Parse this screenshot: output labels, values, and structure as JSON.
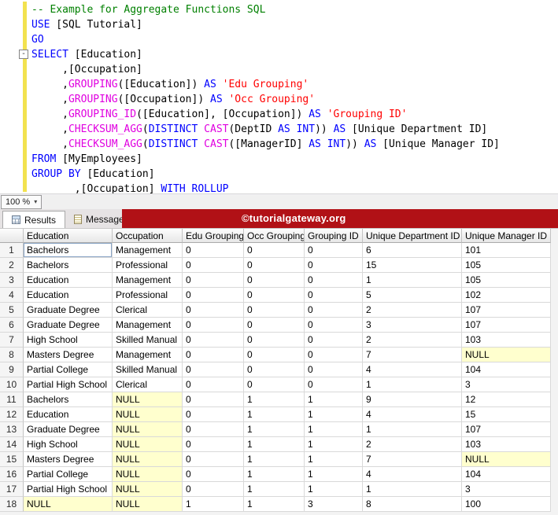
{
  "editor": {
    "zoom": "100 %",
    "lines": [
      [
        {
          "t": "-- Example for Aggregate Functions SQL",
          "c": "comment"
        }
      ],
      [
        {
          "t": "USE",
          "c": "kw"
        },
        {
          "t": " [SQL Tutorial]",
          "c": "plain"
        }
      ],
      [
        {
          "t": "GO",
          "c": "kw"
        }
      ],
      [
        {
          "t": "SELECT",
          "c": "kw"
        },
        {
          "t": " [Education]",
          "c": "plain"
        }
      ],
      [
        {
          "t": "     ,[Occupation]",
          "c": "plain"
        }
      ],
      [
        {
          "t": "     ,",
          "c": "plain"
        },
        {
          "t": "GROUPING",
          "c": "fn"
        },
        {
          "t": "([Education]) ",
          "c": "plain"
        },
        {
          "t": "AS ",
          "c": "kw"
        },
        {
          "t": "'Edu Grouping'",
          "c": "str"
        }
      ],
      [
        {
          "t": "     ,",
          "c": "plain"
        },
        {
          "t": "GROUPING",
          "c": "fn"
        },
        {
          "t": "([Occupation]) ",
          "c": "plain"
        },
        {
          "t": "AS ",
          "c": "kw"
        },
        {
          "t": "'Occ Grouping'",
          "c": "str"
        }
      ],
      [
        {
          "t": "     ,",
          "c": "plain"
        },
        {
          "t": "GROUPING_ID",
          "c": "fn"
        },
        {
          "t": "([Education], [Occupation]) ",
          "c": "plain"
        },
        {
          "t": "AS ",
          "c": "kw"
        },
        {
          "t": "'Grouping ID'",
          "c": "str"
        }
      ],
      [
        {
          "t": "     ,",
          "c": "plain"
        },
        {
          "t": "CHECKSUM_AGG",
          "c": "fn"
        },
        {
          "t": "(",
          "c": "plain"
        },
        {
          "t": "DISTINCT ",
          "c": "kw"
        },
        {
          "t": "CAST",
          "c": "fn"
        },
        {
          "t": "(DeptID ",
          "c": "plain"
        },
        {
          "t": "AS INT",
          "c": "kw"
        },
        {
          "t": ")) ",
          "c": "plain"
        },
        {
          "t": "AS ",
          "c": "kw"
        },
        {
          "t": "[Unique Department ID]",
          "c": "plain"
        }
      ],
      [
        {
          "t": "     ,",
          "c": "plain"
        },
        {
          "t": "CHECKSUM_AGG",
          "c": "fn"
        },
        {
          "t": "(",
          "c": "plain"
        },
        {
          "t": "DISTINCT ",
          "c": "kw"
        },
        {
          "t": "CAST",
          "c": "fn"
        },
        {
          "t": "([ManagerID] ",
          "c": "plain"
        },
        {
          "t": "AS INT",
          "c": "kw"
        },
        {
          "t": ")) ",
          "c": "plain"
        },
        {
          "t": "AS ",
          "c": "kw"
        },
        {
          "t": "[Unique Manager ID]",
          "c": "plain"
        }
      ],
      [
        {
          "t": "FROM",
          "c": "kw"
        },
        {
          "t": " [MyEmployees]",
          "c": "plain"
        }
      ],
      [
        {
          "t": "GROUP BY",
          "c": "kw"
        },
        {
          "t": " [Education]",
          "c": "plain"
        }
      ],
      [
        {
          "t": "       ,[Occupation] ",
          "c": "plain"
        },
        {
          "t": "WITH ROLLUP",
          "c": "kw"
        }
      ]
    ]
  },
  "code_colors": {
    "keyword": "#0000ff",
    "comment": "#008000",
    "function": "#e000e0",
    "string": "#ff0000",
    "plain": "#000000"
  },
  "icons": {
    "dropdown_caret": "▾",
    "fold_collapse": "-"
  },
  "tabs": {
    "results": {
      "label": "Results"
    },
    "messages": {
      "label": "Messages"
    }
  },
  "banner": {
    "text": "©tutorialgateway.org",
    "color": "#b11116"
  },
  "grid": {
    "columns": [
      "Education",
      "Occupation",
      "Edu Grouping",
      "Occ Grouping",
      "Grouping ID",
      "Unique Department ID",
      "Unique Manager ID"
    ],
    "rows": [
      {
        "n": "1",
        "cells": [
          "Bachelors",
          "Management",
          "0",
          "0",
          "0",
          "6",
          "101"
        ]
      },
      {
        "n": "2",
        "cells": [
          "Bachelors",
          "Professional",
          "0",
          "0",
          "0",
          "15",
          "105"
        ]
      },
      {
        "n": "3",
        "cells": [
          "Education",
          "Management",
          "0",
          "0",
          "0",
          "1",
          "105"
        ]
      },
      {
        "n": "4",
        "cells": [
          "Education",
          "Professional",
          "0",
          "0",
          "0",
          "5",
          "102"
        ]
      },
      {
        "n": "5",
        "cells": [
          "Graduate Degree",
          "Clerical",
          "0",
          "0",
          "0",
          "2",
          "107"
        ]
      },
      {
        "n": "6",
        "cells": [
          "Graduate Degree",
          "Management",
          "0",
          "0",
          "0",
          "3",
          "107"
        ]
      },
      {
        "n": "7",
        "cells": [
          "High School",
          "Skilled Manual",
          "0",
          "0",
          "0",
          "2",
          "103"
        ]
      },
      {
        "n": "8",
        "cells": [
          "Masters Degree",
          "Management",
          "0",
          "0",
          "0",
          "7",
          "NULL"
        ]
      },
      {
        "n": "9",
        "cells": [
          "Partial College",
          "Skilled Manual",
          "0",
          "0",
          "0",
          "4",
          "104"
        ]
      },
      {
        "n": "10",
        "cells": [
          "Partial High School",
          "Clerical",
          "0",
          "0",
          "0",
          "1",
          "3"
        ]
      },
      {
        "n": "11",
        "cells": [
          "Bachelors",
          "NULL",
          "0",
          "1",
          "1",
          "9",
          "12"
        ]
      },
      {
        "n": "12",
        "cells": [
          "Education",
          "NULL",
          "0",
          "1",
          "1",
          "4",
          "15"
        ]
      },
      {
        "n": "13",
        "cells": [
          "Graduate Degree",
          "NULL",
          "0",
          "1",
          "1",
          "1",
          "107"
        ]
      },
      {
        "n": "14",
        "cells": [
          "High School",
          "NULL",
          "0",
          "1",
          "1",
          "2",
          "103"
        ]
      },
      {
        "n": "15",
        "cells": [
          "Masters Degree",
          "NULL",
          "0",
          "1",
          "1",
          "7",
          "NULL"
        ]
      },
      {
        "n": "16",
        "cells": [
          "Partial College",
          "NULL",
          "0",
          "1",
          "1",
          "4",
          "104"
        ]
      },
      {
        "n": "17",
        "cells": [
          "Partial High School",
          "NULL",
          "0",
          "1",
          "1",
          "1",
          "3"
        ]
      },
      {
        "n": "18",
        "cells": [
          "NULL",
          "NULL",
          "1",
          "1",
          "3",
          "8",
          "100"
        ]
      }
    ],
    "selected_cell": {
      "row": 0,
      "col": 0
    },
    "null_marker": "NULL",
    "null_color": "#ffffce"
  }
}
